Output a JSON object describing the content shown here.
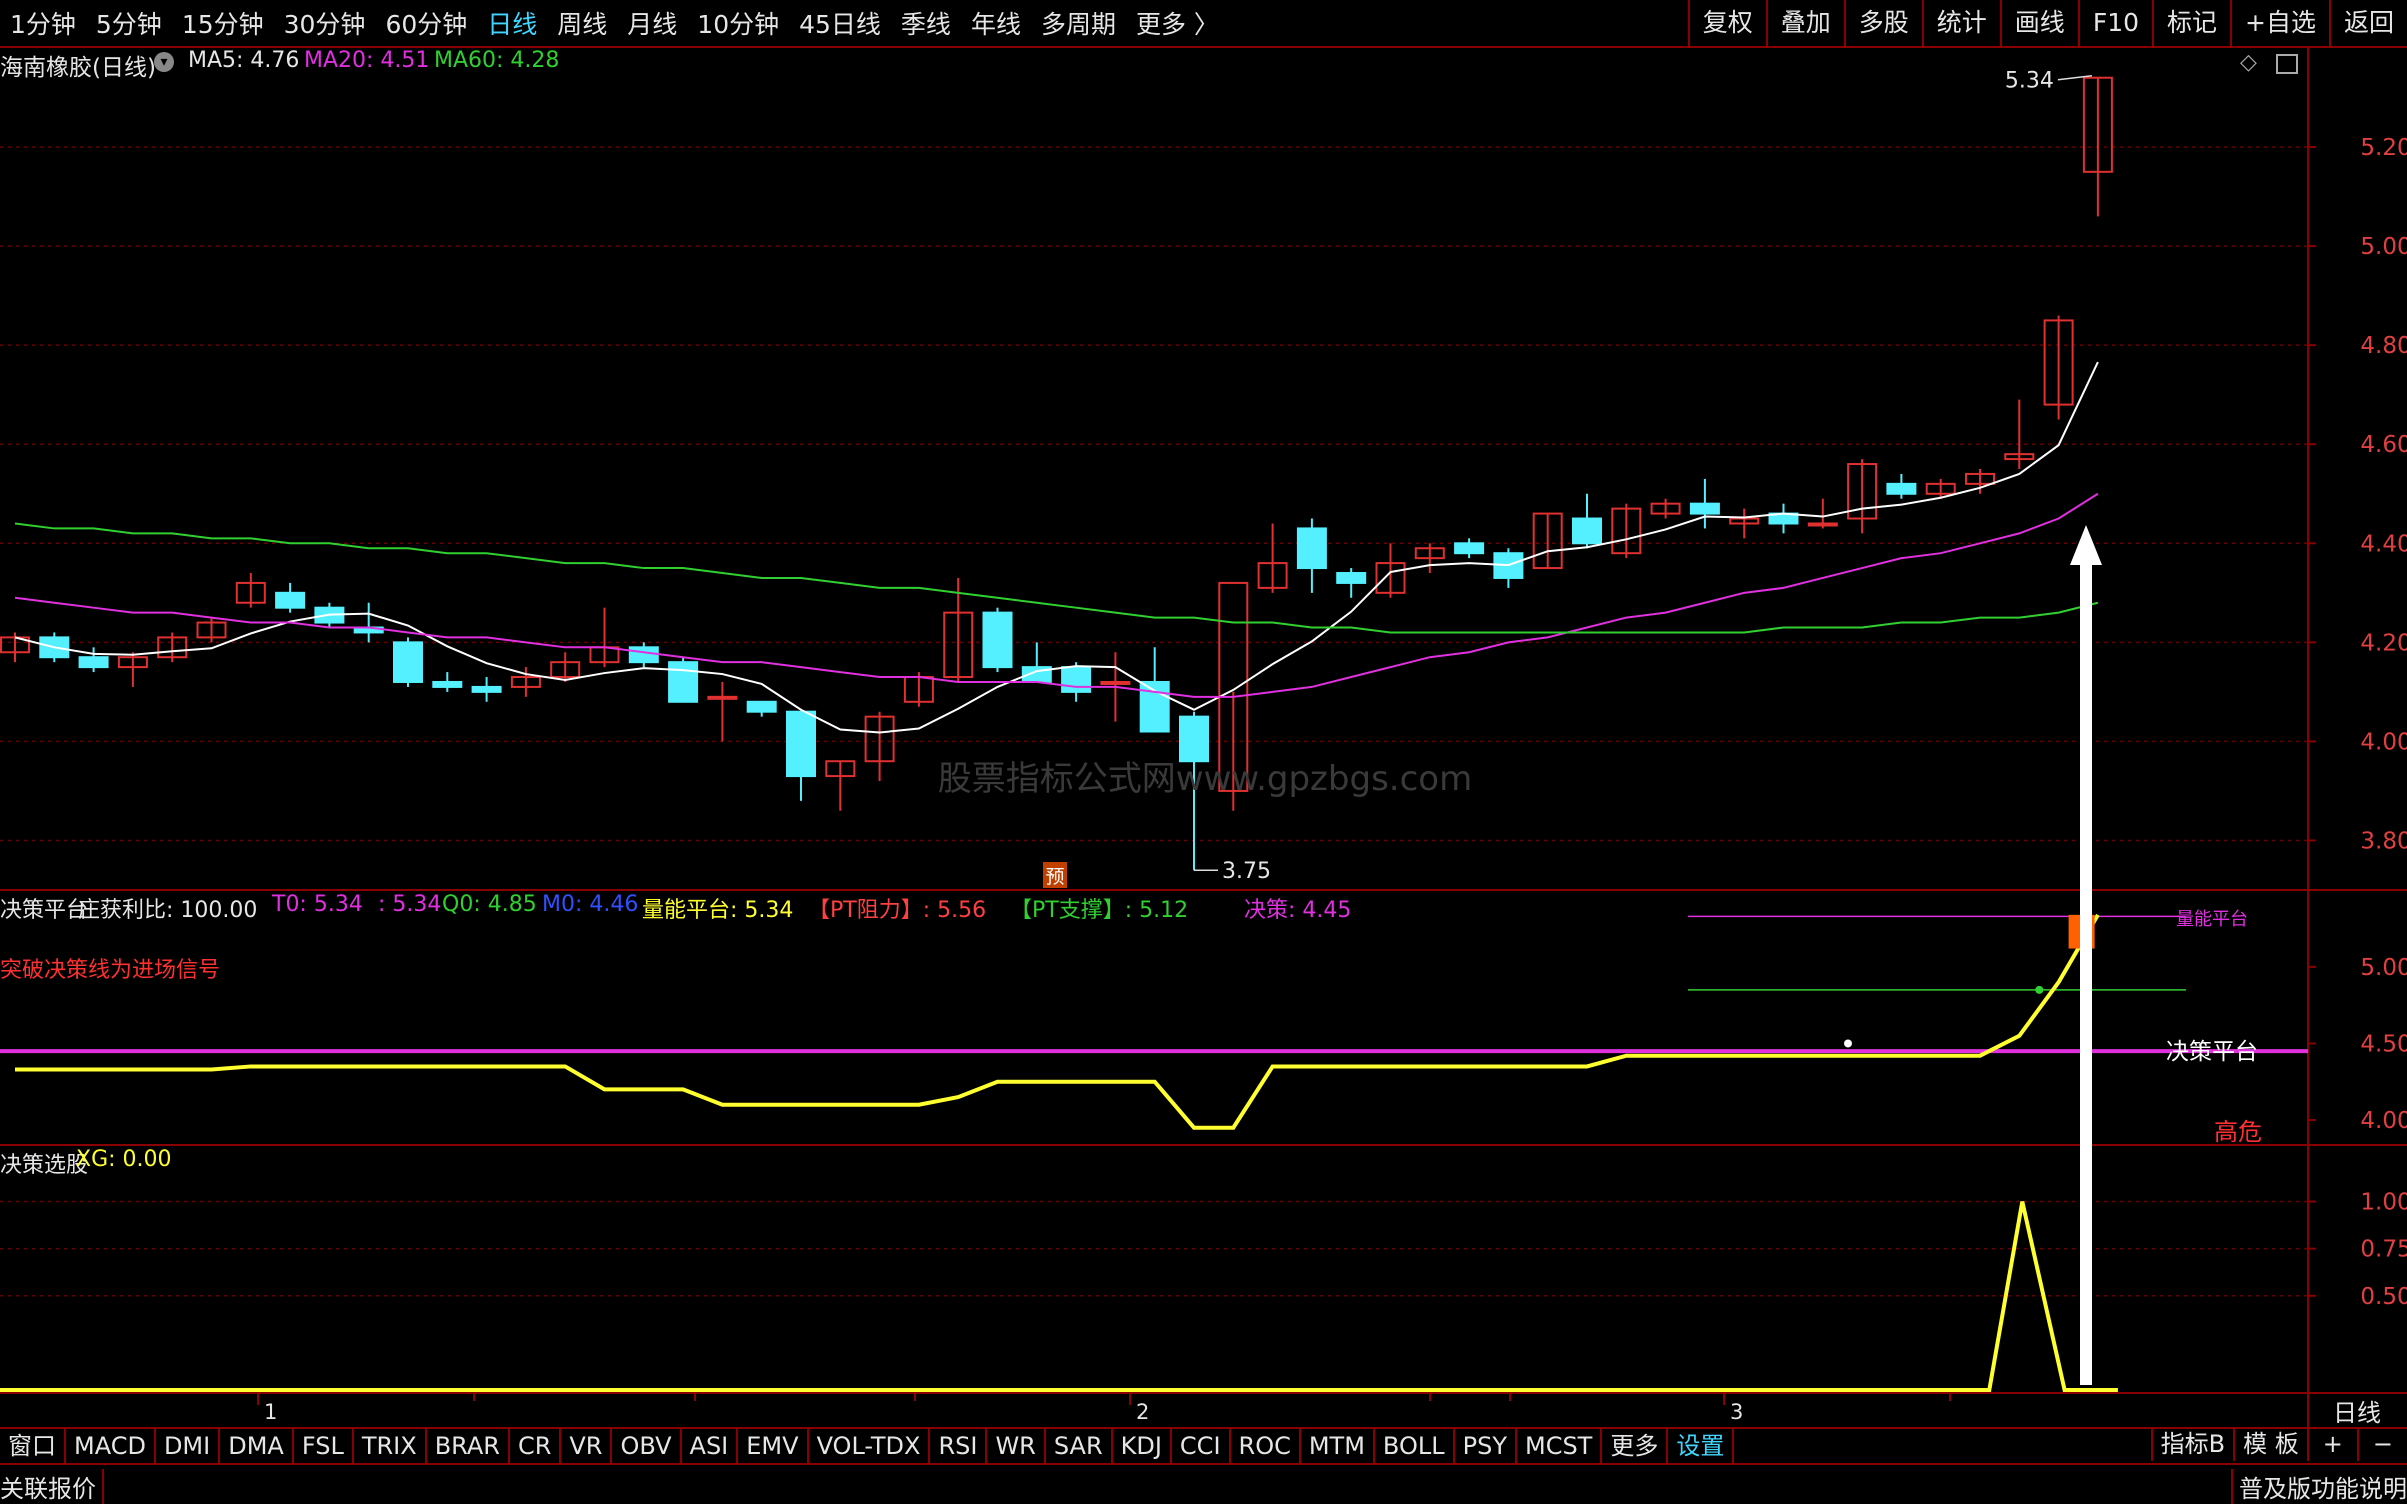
{
  "period_tabs": [
    {
      "label": "1分钟"
    },
    {
      "label": "5分钟"
    },
    {
      "label": "15分钟"
    },
    {
      "label": "30分钟"
    },
    {
      "label": "60分钟"
    },
    {
      "label": "日线"
    },
    {
      "label": "周线"
    },
    {
      "label": "月线"
    },
    {
      "label": "10分钟"
    },
    {
      "label": "45日线"
    },
    {
      "label": "季线"
    },
    {
      "label": "年线"
    },
    {
      "label": "多周期"
    },
    {
      "label": "更多 〉"
    }
  ],
  "active_period": "日线",
  "tools": [
    {
      "label": "复权"
    },
    {
      "label": "叠加"
    },
    {
      "label": "多股"
    },
    {
      "label": "统计"
    },
    {
      "label": "画线"
    },
    {
      "label": "F10"
    },
    {
      "label": "标记"
    },
    {
      "label": "+自选"
    },
    {
      "label": "返回"
    }
  ],
  "main": {
    "stock_title": "海南橡胶(日线)",
    "ma5": "MA5: 4.76",
    "ma20": "MA20: 4.51",
    "ma60": "MA60: 4.28",
    "high_label": "5.34",
    "low_label": "3.75",
    "yu_badge": "预",
    "watermark": "股票指标公式网www.gpzbgs.com",
    "y_ticks": [
      "5.20",
      "5.00",
      "4.80",
      "4.60",
      "4.40",
      "4.20",
      "4.00",
      "3.80"
    ]
  },
  "mid": {
    "title": "决策平台",
    "profit_ratio": "庄获利比: 100.00",
    "t0": "T0: 5.34",
    "t0b": ": 5.34",
    "q0": "Q0: 4.85",
    "m0": "M0: 4.46",
    "volume_platform": "量能平台: 5.34",
    "pt_resist": "【PT阻力】: 5.56",
    "pt_support": "【PT支撑】: 5.12",
    "decision": "决策: 4.45",
    "hint": "突破决策线为进场信号",
    "label_decision_platform": "决策平台",
    "label_high_risk": "高危",
    "label_volume_platform": "量能平台",
    "y_ticks": [
      "5.00",
      "4.50",
      "4.00"
    ]
  },
  "bottom": {
    "title": "决策选股",
    "xg": "XG: 0.00",
    "y_ticks": [
      "1.00",
      "0.75",
      "0.50"
    ],
    "month_marks": [
      "1",
      "2",
      "3"
    ],
    "period_label": "日线"
  },
  "indicator_tabs": [
    {
      "label": "窗口"
    },
    {
      "label": "MACD"
    },
    {
      "label": "DMI"
    },
    {
      "label": "DMA"
    },
    {
      "label": "FSL"
    },
    {
      "label": "TRIX"
    },
    {
      "label": "BRAR"
    },
    {
      "label": "CR"
    },
    {
      "label": "VR"
    },
    {
      "label": "OBV"
    },
    {
      "label": "ASI"
    },
    {
      "label": "EMV"
    },
    {
      "label": "VOL-TDX"
    },
    {
      "label": "RSI"
    },
    {
      "label": "WR"
    },
    {
      "label": "SAR"
    },
    {
      "label": "KDJ"
    },
    {
      "label": "CCI"
    },
    {
      "label": "ROC"
    },
    {
      "label": "MTM"
    },
    {
      "label": "BOLL"
    },
    {
      "label": "PSY"
    },
    {
      "label": "MCST"
    },
    {
      "label": "更多"
    },
    {
      "label": "设置"
    }
  ],
  "indicator_right": {
    "template_b": "指标B",
    "template": "模 板",
    "plus": "+",
    "minus": "−"
  },
  "status": {
    "left": "关联报价",
    "right": "普及版功能说明"
  },
  "colors": {
    "up": "#e03030",
    "down": "#54f0ff",
    "ma5": "#ffffff",
    "ma20": "#e030e0",
    "ma60": "#30d030",
    "yellow": "#ffff30",
    "border": "#8a0000"
  },
  "chart_data": {
    "type": "candlestick",
    "ylim": [
      3.7,
      5.4
    ],
    "series_candles": [
      {
        "o": 4.18,
        "h": 4.22,
        "l": 4.16,
        "c": 4.21
      },
      {
        "o": 4.21,
        "h": 4.22,
        "l": 4.16,
        "c": 4.17
      },
      {
        "o": 4.17,
        "h": 4.19,
        "l": 4.14,
        "c": 4.15
      },
      {
        "o": 4.15,
        "h": 4.18,
        "l": 4.11,
        "c": 4.17
      },
      {
        "o": 4.17,
        "h": 4.22,
        "l": 4.16,
        "c": 4.21
      },
      {
        "o": 4.21,
        "h": 4.25,
        "l": 4.2,
        "c": 4.24
      },
      {
        "o": 4.28,
        "h": 4.34,
        "l": 4.27,
        "c": 4.32
      },
      {
        "o": 4.3,
        "h": 4.32,
        "l": 4.26,
        "c": 4.27
      },
      {
        "o": 4.27,
        "h": 4.28,
        "l": 4.23,
        "c": 4.24
      },
      {
        "o": 4.23,
        "h": 4.28,
        "l": 4.2,
        "c": 4.22
      },
      {
        "o": 4.2,
        "h": 4.21,
        "l": 4.11,
        "c": 4.12
      },
      {
        "o": 4.12,
        "h": 4.14,
        "l": 4.1,
        "c": 4.11
      },
      {
        "o": 4.11,
        "h": 4.13,
        "l": 4.08,
        "c": 4.1
      },
      {
        "o": 4.11,
        "h": 4.15,
        "l": 4.09,
        "c": 4.13
      },
      {
        "o": 4.13,
        "h": 4.18,
        "l": 4.12,
        "c": 4.16
      },
      {
        "o": 4.16,
        "h": 4.27,
        "l": 4.15,
        "c": 4.19
      },
      {
        "o": 4.19,
        "h": 4.2,
        "l": 4.15,
        "c": 4.16
      },
      {
        "o": 4.16,
        "h": 4.17,
        "l": 4.08,
        "c": 4.08
      },
      {
        "o": 4.09,
        "h": 4.12,
        "l": 4.0,
        "c": 4.09
      },
      {
        "o": 4.08,
        "h": 4.08,
        "l": 4.05,
        "c": 4.06
      },
      {
        "o": 4.06,
        "h": 4.06,
        "l": 3.88,
        "c": 3.93
      },
      {
        "o": 3.93,
        "h": 3.96,
        "l": 3.86,
        "c": 3.96
      },
      {
        "o": 3.96,
        "h": 4.06,
        "l": 3.92,
        "c": 4.05
      },
      {
        "o": 4.08,
        "h": 4.14,
        "l": 4.07,
        "c": 4.13
      },
      {
        "o": 4.13,
        "h": 4.33,
        "l": 4.12,
        "c": 4.26
      },
      {
        "o": 4.26,
        "h": 4.27,
        "l": 4.14,
        "c": 4.15
      },
      {
        "o": 4.15,
        "h": 4.2,
        "l": 4.12,
        "c": 4.12
      },
      {
        "o": 4.15,
        "h": 4.16,
        "l": 4.08,
        "c": 4.1
      },
      {
        "o": 4.12,
        "h": 4.18,
        "l": 4.04,
        "c": 4.12
      },
      {
        "o": 4.12,
        "h": 4.19,
        "l": 4.03,
        "c": 4.02
      },
      {
        "o": 4.05,
        "h": 4.06,
        "l": 3.74,
        "c": 3.96
      },
      {
        "o": 3.9,
        "h": 4.1,
        "l": 3.86,
        "c": 4.32
      },
      {
        "o": 4.31,
        "h": 4.44,
        "l": 4.3,
        "c": 4.36
      },
      {
        "o": 4.43,
        "h": 4.45,
        "l": 4.3,
        "c": 4.35
      },
      {
        "o": 4.34,
        "h": 4.35,
        "l": 4.29,
        "c": 4.32
      },
      {
        "o": 4.3,
        "h": 4.4,
        "l": 4.29,
        "c": 4.36
      },
      {
        "o": 4.37,
        "h": 4.4,
        "l": 4.34,
        "c": 4.39
      },
      {
        "o": 4.4,
        "h": 4.41,
        "l": 4.37,
        "c": 4.38
      },
      {
        "o": 4.38,
        "h": 4.39,
        "l": 4.31,
        "c": 4.33
      },
      {
        "o": 4.35,
        "h": 4.46,
        "l": 4.35,
        "c": 4.46
      },
      {
        "o": 4.45,
        "h": 4.5,
        "l": 4.39,
        "c": 4.4
      },
      {
        "o": 4.38,
        "h": 4.48,
        "l": 4.37,
        "c": 4.47
      },
      {
        "o": 4.46,
        "h": 4.49,
        "l": 4.45,
        "c": 4.48
      },
      {
        "o": 4.48,
        "h": 4.53,
        "l": 4.43,
        "c": 4.46
      },
      {
        "o": 4.44,
        "h": 4.47,
        "l": 4.41,
        "c": 4.45
      },
      {
        "o": 4.46,
        "h": 4.48,
        "l": 4.42,
        "c": 4.44
      },
      {
        "o": 4.44,
        "h": 4.49,
        "l": 4.43,
        "c": 4.44
      },
      {
        "o": 4.45,
        "h": 4.57,
        "l": 4.42,
        "c": 4.56
      },
      {
        "o": 4.52,
        "h": 4.54,
        "l": 4.49,
        "c": 4.5
      },
      {
        "o": 4.5,
        "h": 4.53,
        "l": 4.49,
        "c": 4.52
      },
      {
        "o": 4.52,
        "h": 4.55,
        "l": 4.5,
        "c": 4.54
      },
      {
        "o": 4.57,
        "h": 4.69,
        "l": 4.55,
        "c": 4.58
      },
      {
        "o": 4.68,
        "h": 4.86,
        "l": 4.65,
        "c": 4.85
      },
      {
        "o": 5.15,
        "h": 5.34,
        "l": 5.06,
        "c": 5.34
      }
    ]
  }
}
